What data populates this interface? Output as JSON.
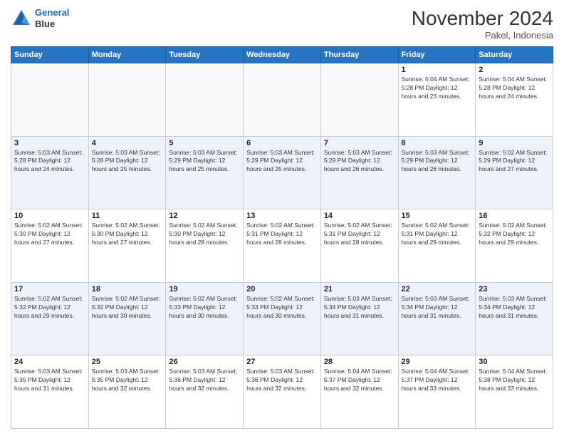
{
  "header": {
    "logo_line1": "General",
    "logo_line2": "Blue",
    "main_title": "November 2024",
    "subtitle": "Pakel, Indonesia"
  },
  "calendar": {
    "days_of_week": [
      "Sunday",
      "Monday",
      "Tuesday",
      "Wednesday",
      "Thursday",
      "Friday",
      "Saturday"
    ],
    "weeks": [
      [
        {
          "day": "",
          "info": ""
        },
        {
          "day": "",
          "info": ""
        },
        {
          "day": "",
          "info": ""
        },
        {
          "day": "",
          "info": ""
        },
        {
          "day": "",
          "info": ""
        },
        {
          "day": "1",
          "info": "Sunrise: 5:04 AM\nSunset: 5:28 PM\nDaylight: 12 hours and 23 minutes."
        },
        {
          "day": "2",
          "info": "Sunrise: 5:04 AM\nSunset: 5:28 PM\nDaylight: 12 hours and 24 minutes."
        }
      ],
      [
        {
          "day": "3",
          "info": "Sunrise: 5:03 AM\nSunset: 5:28 PM\nDaylight: 12 hours and 24 minutes."
        },
        {
          "day": "4",
          "info": "Sunrise: 5:03 AM\nSunset: 5:28 PM\nDaylight: 12 hours and 25 minutes."
        },
        {
          "day": "5",
          "info": "Sunrise: 5:03 AM\nSunset: 5:29 PM\nDaylight: 12 hours and 25 minutes."
        },
        {
          "day": "6",
          "info": "Sunrise: 5:03 AM\nSunset: 5:29 PM\nDaylight: 12 hours and 25 minutes."
        },
        {
          "day": "7",
          "info": "Sunrise: 5:03 AM\nSunset: 5:29 PM\nDaylight: 12 hours and 26 minutes."
        },
        {
          "day": "8",
          "info": "Sunrise: 5:03 AM\nSunset: 5:29 PM\nDaylight: 12 hours and 26 minutes."
        },
        {
          "day": "9",
          "info": "Sunrise: 5:02 AM\nSunset: 5:29 PM\nDaylight: 12 hours and 27 minutes."
        }
      ],
      [
        {
          "day": "10",
          "info": "Sunrise: 5:02 AM\nSunset: 5:30 PM\nDaylight: 12 hours and 27 minutes."
        },
        {
          "day": "11",
          "info": "Sunrise: 5:02 AM\nSunset: 5:30 PM\nDaylight: 12 hours and 27 minutes."
        },
        {
          "day": "12",
          "info": "Sunrise: 5:02 AM\nSunset: 5:30 PM\nDaylight: 12 hours and 28 minutes."
        },
        {
          "day": "13",
          "info": "Sunrise: 5:02 AM\nSunset: 5:31 PM\nDaylight: 12 hours and 28 minutes."
        },
        {
          "day": "14",
          "info": "Sunrise: 5:02 AM\nSunset: 5:31 PM\nDaylight: 12 hours and 28 minutes."
        },
        {
          "day": "15",
          "info": "Sunrise: 5:02 AM\nSunset: 5:31 PM\nDaylight: 12 hours and 29 minutes."
        },
        {
          "day": "16",
          "info": "Sunrise: 5:02 AM\nSunset: 5:32 PM\nDaylight: 12 hours and 29 minutes."
        }
      ],
      [
        {
          "day": "17",
          "info": "Sunrise: 5:02 AM\nSunset: 5:32 PM\nDaylight: 12 hours and 29 minutes."
        },
        {
          "day": "18",
          "info": "Sunrise: 5:02 AM\nSunset: 5:32 PM\nDaylight: 12 hours and 30 minutes."
        },
        {
          "day": "19",
          "info": "Sunrise: 5:02 AM\nSunset: 5:33 PM\nDaylight: 12 hours and 30 minutes."
        },
        {
          "day": "20",
          "info": "Sunrise: 5:02 AM\nSunset: 5:33 PM\nDaylight: 12 hours and 30 minutes."
        },
        {
          "day": "21",
          "info": "Sunrise: 5:03 AM\nSunset: 5:34 PM\nDaylight: 12 hours and 31 minutes."
        },
        {
          "day": "22",
          "info": "Sunrise: 5:03 AM\nSunset: 5:34 PM\nDaylight: 12 hours and 31 minutes."
        },
        {
          "day": "23",
          "info": "Sunrise: 5:03 AM\nSunset: 5:34 PM\nDaylight: 12 hours and 31 minutes."
        }
      ],
      [
        {
          "day": "24",
          "info": "Sunrise: 5:03 AM\nSunset: 5:35 PM\nDaylight: 12 hours and 31 minutes."
        },
        {
          "day": "25",
          "info": "Sunrise: 5:03 AM\nSunset: 5:35 PM\nDaylight: 12 hours and 32 minutes."
        },
        {
          "day": "26",
          "info": "Sunrise: 5:03 AM\nSunset: 5:36 PM\nDaylight: 12 hours and 32 minutes."
        },
        {
          "day": "27",
          "info": "Sunrise: 5:03 AM\nSunset: 5:36 PM\nDaylight: 12 hours and 32 minutes."
        },
        {
          "day": "28",
          "info": "Sunrise: 5:04 AM\nSunset: 5:37 PM\nDaylight: 12 hours and 32 minutes."
        },
        {
          "day": "29",
          "info": "Sunrise: 5:04 AM\nSunset: 5:37 PM\nDaylight: 12 hours and 33 minutes."
        },
        {
          "day": "30",
          "info": "Sunrise: 5:04 AM\nSunset: 5:38 PM\nDaylight: 12 hours and 33 minutes."
        }
      ]
    ]
  }
}
